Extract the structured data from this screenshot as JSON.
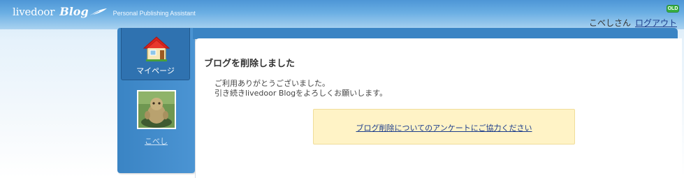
{
  "header": {
    "logo_text": "livedoor",
    "logo_blog": "Blog",
    "tagline": "Personal Publishing Assistant",
    "old_badge": "OLD",
    "username": "こべしさん",
    "logout_label": "ログアウト"
  },
  "sidebar": {
    "mypage_label": "マイページ",
    "avatar_name": "こべし"
  },
  "main": {
    "title": "ブログを削除しました",
    "message_line1": "ご利用ありがとうございました。",
    "message_line2": "引き続きlivedoor Blogをよろしくお願いします。",
    "survey_link": "ブログ削除についてのアンケートにご協力ください"
  },
  "colors": {
    "header_blue": "#4d96d6",
    "panel_blue": "#3a84c4",
    "survey_bg": "#fff3c6",
    "link": "#1b3c8c"
  }
}
